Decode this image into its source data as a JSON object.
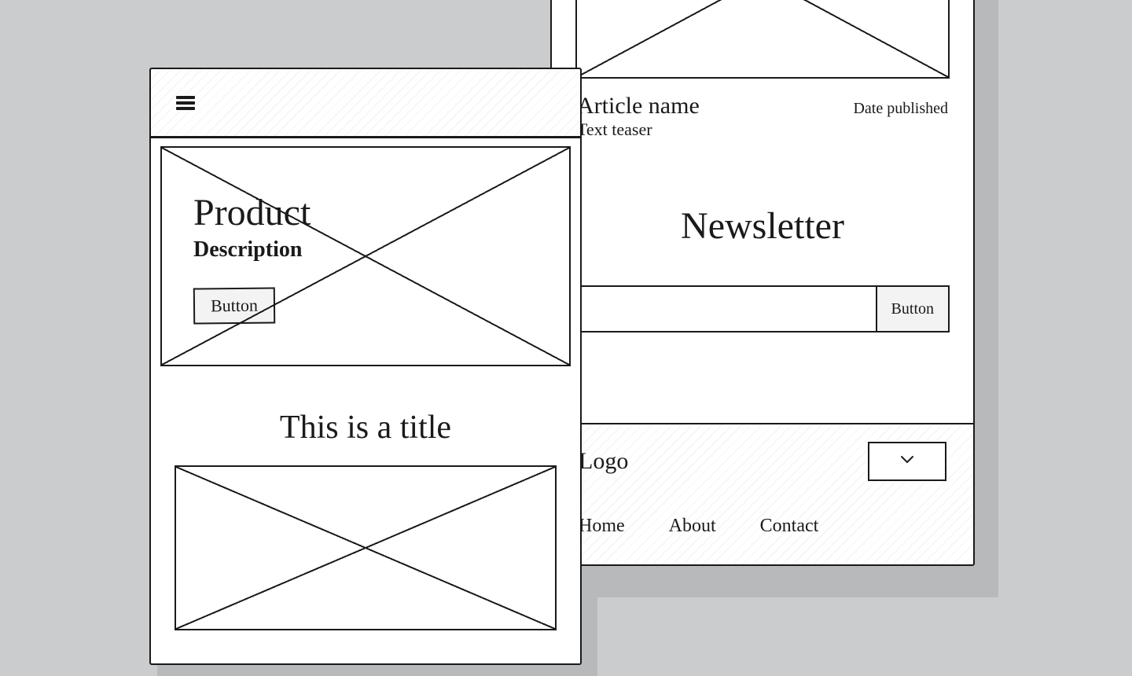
{
  "frameA": {
    "hero_title": "Product",
    "hero_desc": "Description",
    "hero_button": "Button",
    "section_title": "This is a title"
  },
  "frameB": {
    "article_name": "Article name",
    "date_label": "Date published",
    "teaser": "Text teaser",
    "newsletter_title": "Newsletter",
    "newsletter_button": "Button",
    "footer_logo": "Logo",
    "nav": {
      "home": "Home",
      "about": "About",
      "contact": "Contact"
    }
  }
}
